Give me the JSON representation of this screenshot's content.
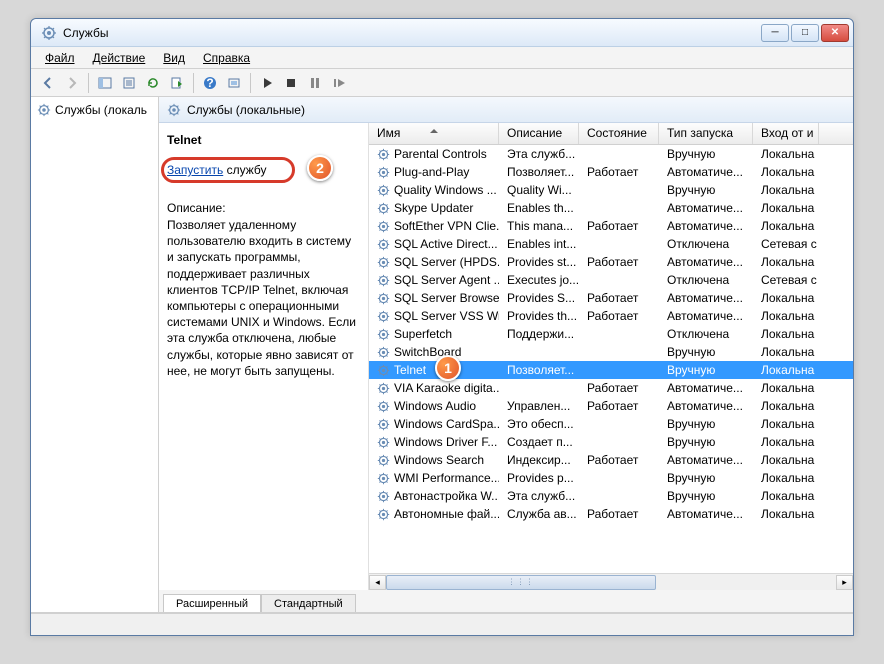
{
  "window": {
    "title": "Службы"
  },
  "menu": {
    "file": "Файл",
    "action": "Действие",
    "view": "Вид",
    "help": "Справка"
  },
  "tree": {
    "root": "Службы (локаль"
  },
  "header": {
    "title": "Службы (локальные)"
  },
  "detail": {
    "service_name": "Telnet",
    "start_link": "Запустить",
    "start_suffix": " службу",
    "desc_label": "Описание:",
    "desc_text": "Позволяет удаленному пользователю входить в систему и запускать программы, поддерживает различных клиентов TCP/IP Telnet, включая компьютеры с операционными системами UNIX и Windows. Если эта служба отключена, любые службы, которые явно зависят от нее, не могут быть запущены."
  },
  "columns": {
    "name": "Имя",
    "desc": "Описание",
    "state": "Состояние",
    "startup": "Тип запуска",
    "logon": "Вход от и"
  },
  "services": [
    {
      "name": "Parental Controls",
      "desc": "Эта служб...",
      "state": "",
      "startup": "Вручную",
      "logon": "Локальна"
    },
    {
      "name": "Plug-and-Play",
      "desc": "Позволяет...",
      "state": "Работает",
      "startup": "Автоматиче...",
      "logon": "Локальна"
    },
    {
      "name": "Quality Windows ...",
      "desc": "Quality Wi...",
      "state": "",
      "startup": "Вручную",
      "logon": "Локальна"
    },
    {
      "name": "Skype Updater",
      "desc": "Enables th...",
      "state": "",
      "startup": "Автоматиче...",
      "logon": "Локальна"
    },
    {
      "name": "SoftEther VPN Clie...",
      "desc": "This mana...",
      "state": "Работает",
      "startup": "Автоматиче...",
      "logon": "Локальна"
    },
    {
      "name": "SQL Active Direct...",
      "desc": "Enables int...",
      "state": "",
      "startup": "Отключена",
      "logon": "Сетевая с"
    },
    {
      "name": "SQL Server (HPDS...",
      "desc": "Provides st...",
      "state": "Работает",
      "startup": "Автоматиче...",
      "logon": "Локальна"
    },
    {
      "name": "SQL Server Agent ...",
      "desc": "Executes jo...",
      "state": "",
      "startup": "Отключена",
      "logon": "Сетевая с"
    },
    {
      "name": "SQL Server Browser",
      "desc": "Provides S...",
      "state": "Работает",
      "startup": "Автоматиче...",
      "logon": "Локальна"
    },
    {
      "name": "SQL Server VSS Wr...",
      "desc": "Provides th...",
      "state": "Работает",
      "startup": "Автоматиче...",
      "logon": "Локальна"
    },
    {
      "name": "Superfetch",
      "desc": "Поддержи...",
      "state": "",
      "startup": "Отключена",
      "logon": "Локальна"
    },
    {
      "name": "SwitchBoard",
      "desc": "",
      "state": "",
      "startup": "Вручную",
      "logon": "Локальна"
    },
    {
      "name": "Telnet",
      "desc": "Позволяет...",
      "state": "",
      "startup": "Вручную",
      "logon": "Локальна",
      "selected": true
    },
    {
      "name": "VIA Karaoke digita...",
      "desc": "",
      "state": "Работает",
      "startup": "Автоматиче...",
      "logon": "Локальна"
    },
    {
      "name": "Windows Audio",
      "desc": "Управлен...",
      "state": "Работает",
      "startup": "Автоматиче...",
      "logon": "Локальна"
    },
    {
      "name": "Windows CardSpa...",
      "desc": "Это обесп...",
      "state": "",
      "startup": "Вручную",
      "logon": "Локальна"
    },
    {
      "name": "Windows Driver F...",
      "desc": "Создает п...",
      "state": "",
      "startup": "Вручную",
      "logon": "Локальна"
    },
    {
      "name": "Windows Search",
      "desc": "Индексир...",
      "state": "Работает",
      "startup": "Автоматиче...",
      "logon": "Локальна"
    },
    {
      "name": "WMI Performance...",
      "desc": "Provides p...",
      "state": "",
      "startup": "Вручную",
      "logon": "Локальна"
    },
    {
      "name": "Автонастройка W...",
      "desc": "Эта служб...",
      "state": "",
      "startup": "Вручную",
      "logon": "Локальна"
    },
    {
      "name": "Автономные фай...",
      "desc": "Служба ав...",
      "state": "Работает",
      "startup": "Автоматиче...",
      "logon": "Локальна"
    }
  ],
  "tabs": {
    "extended": "Расширенный",
    "standard": "Стандартный"
  },
  "markers": {
    "one": "1",
    "two": "2"
  }
}
